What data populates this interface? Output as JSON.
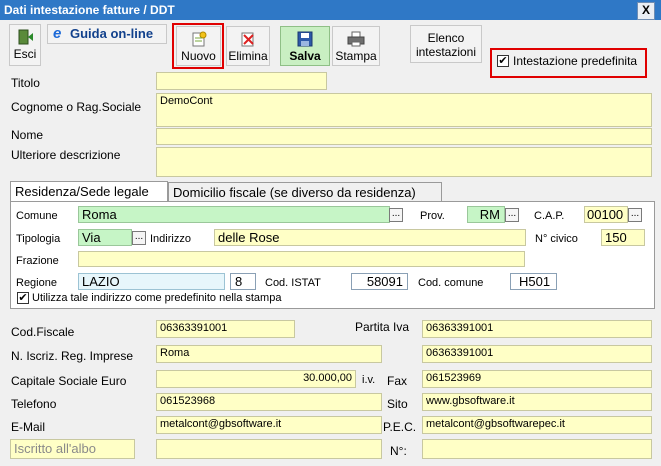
{
  "window": {
    "title": "Dati intestazione fatture / DDT",
    "close": "X"
  },
  "toolbar": {
    "esci": "Esci",
    "guida": "Guida on-line",
    "nuovo": "Nuovo",
    "elimina": "Elimina",
    "salva": "Salva",
    "stampa": "Stampa",
    "elenco_line1": "Elenco",
    "elenco_line2": "intestazioni",
    "intestazione_predefinita": "Intestazione predefinita"
  },
  "header": {
    "titolo_label": "Titolo",
    "titolo_value": "",
    "cognome_label": "Cognome o Rag.Sociale",
    "cognome_value": "DemoCont",
    "nome_label": "Nome",
    "nome_value": "",
    "ulteriore_label": "Ulteriore descrizione",
    "ulteriore_value": ""
  },
  "tabs": [
    "Residenza/Sede legale",
    "Domicilio fiscale (se diverso da residenza)"
  ],
  "residenza": {
    "comune_label": "Comune",
    "comune_value": "Roma",
    "prov_label": "Prov.",
    "prov_value": "RM",
    "cap_label": "C.A.P.",
    "cap_value": "00100",
    "tipologia_label": "Tipologia",
    "tipologia_value": "Via",
    "indirizzo_label": "Indirizzo",
    "indirizzo_value": "delle Rose",
    "civico_label": "N° civico",
    "civico_value": "150",
    "frazione_label": "Frazione",
    "frazione_value": "",
    "regione_label": "Regione",
    "regione_value": "LAZIO",
    "regione_code": "8",
    "istat_label": "Cod. ISTAT",
    "istat_value": "58091",
    "comune_code_label": "Cod. comune",
    "comune_code_value": "H501",
    "utilizza_label": "Utilizza tale indirizzo come predefinito nella stampa"
  },
  "fiscal": {
    "codfiscale_label": "Cod.Fiscale",
    "codfiscale_value": "06363391001",
    "partitaiva_label": "Partita Iva",
    "partitaiva_value": "06363391001",
    "iscriz_label": "N. Iscriz. Reg. Imprese",
    "iscriz_value": "Roma",
    "iscriz_value2": "06363391001",
    "capitale_label": "Capitale Sociale Euro",
    "capitale_value": "30.000,00",
    "capitale_suffix": "i.v.",
    "fax_label": "Fax",
    "fax_value": "061523969",
    "telefono_label": "Telefono",
    "telefono_value": "061523968",
    "sito_label": "Sito",
    "sito_value": "www.gbsoftware.it",
    "email_label": "E-Mail",
    "email_value": "metalcont@gbsoftware.it",
    "pec_label": "P.E.C.",
    "pec_value": "metalcont@gbsoftwarepec.it",
    "albo_placeholder": "Iscritto all'albo",
    "numero_label": "N°:",
    "numero_value": ""
  },
  "colors": {
    "titlebar": "#2f78c6",
    "field": "#ffffc6",
    "field_green": "#c6f5c6",
    "highlight": "#e00000"
  }
}
